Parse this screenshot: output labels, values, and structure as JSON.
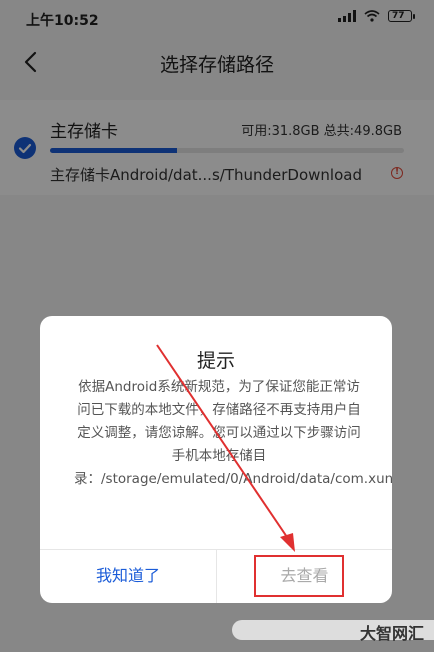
{
  "status": {
    "time": "上午10:52",
    "battery": "77"
  },
  "nav": {
    "title": "选择存储路径"
  },
  "storage": {
    "name": "主存储卡",
    "stats": "可用:31.8GB  总共:49.8GB",
    "used_fraction": 0.36,
    "path": "主存储卡Android/dat...s/ThunderDownload"
  },
  "dialog": {
    "title": "提示",
    "body": "依据Android系统新规范，为了保证您能正常访问已下载的本地文件，存储路径不再支持用户自定义调整，请您谅解。您可以通过以下步骤访问手机本地存储目录：/storage/emulated/0/Android/data/com.xunlei.downloadprovider/files/ThunderDownload",
    "ok": "我知道了",
    "view": "去查看"
  },
  "watermark": "大智网汇",
  "colors": {
    "accent": "#1b5cd8",
    "annotation": "#e03030"
  }
}
